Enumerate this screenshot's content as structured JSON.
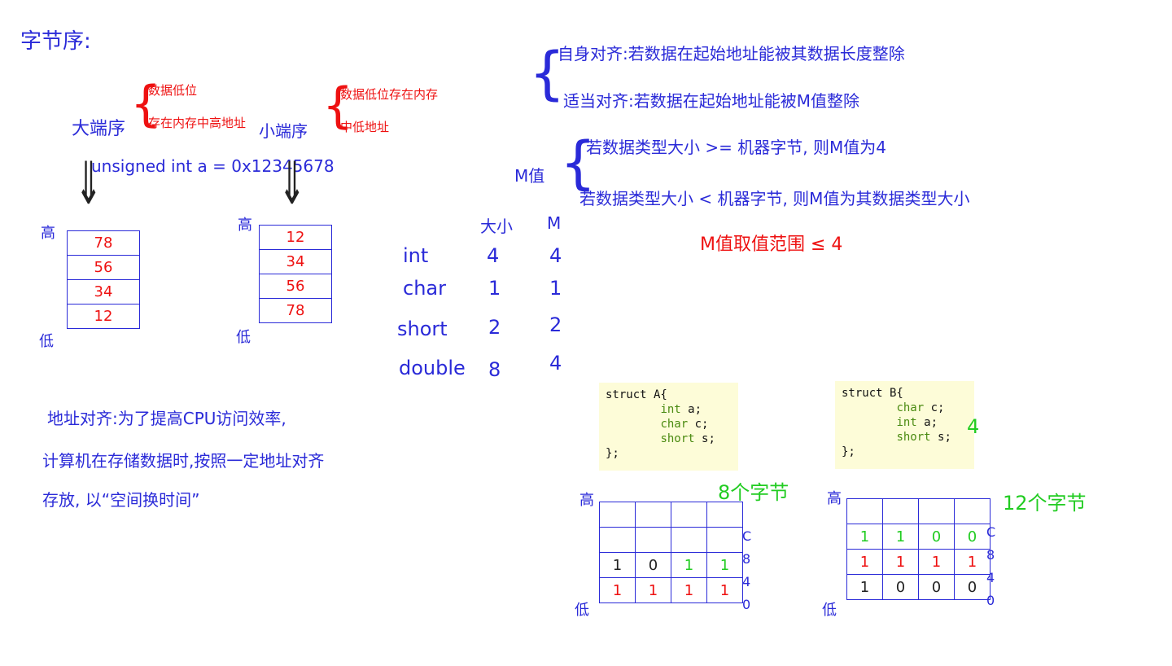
{
  "colors": {
    "blue": "#2a2ad8",
    "red": "#ee1111",
    "green": "#22cc22",
    "code_bg": "#fdfcd8"
  },
  "title": "字节序:",
  "big_endian": {
    "label": "大端序",
    "note1": "数据低位",
    "note2": "存在内存中高地址"
  },
  "little_endian": {
    "label": "小端序",
    "note1": "数据低位存在内存",
    "note2": "中低地址"
  },
  "declaration": "unsigned int a = 0x12345678",
  "high": "高",
  "low": "低",
  "big_cells": [
    "78",
    "56",
    "34",
    "12"
  ],
  "little_cells": [
    "12",
    "34",
    "56",
    "78"
  ],
  "size_table": {
    "headers": [
      "大小",
      "M"
    ],
    "rows": [
      [
        "int",
        "4",
        "4"
      ],
      [
        "char",
        "1",
        "1"
      ],
      [
        "short",
        "2",
        "2"
      ],
      [
        "double",
        "8",
        "4"
      ]
    ]
  },
  "self_align": {
    "label": "自身对齐",
    "text": ":若数据在起始地址能被其数据长度整除"
  },
  "proper_align": {
    "label": "适当对齐",
    "text": ":若数据在起始地址能被M值整除"
  },
  "m_value": {
    "label": "M值",
    "rule1": "若数据类型大小 >= 机器字节, 则M值为4",
    "rule2": "若数据类型大小 < 机器字节, 则M值为其数据类型大小",
    "range": "M值取值范围 ≤ 4"
  },
  "addr_align": {
    "line1": "地址对齐:为了提高CPU访问效率,",
    "line2": "计算机在存储数据时,按照一定地址对齐",
    "line3": "存放, 以“空间换时间”"
  },
  "struct_a": {
    "line0": "struct A{",
    "fields": [
      [
        "int",
        "a;"
      ],
      [
        "char",
        "c;"
      ],
      [
        "short",
        "s;"
      ]
    ],
    "close": "};",
    "size": "8个字节",
    "rows": [
      [
        "",
        "",
        "",
        ""
      ],
      [
        "",
        "",
        "",
        ""
      ],
      [
        "1",
        "0",
        "1",
        "1"
      ],
      [
        "1",
        "1",
        "1",
        "1"
      ]
    ]
  },
  "struct_b": {
    "line0": "struct B{",
    "fields": [
      [
        "char",
        "c;"
      ],
      [
        "int",
        "a;"
      ],
      [
        "short",
        "s;"
      ]
    ],
    "close": "};",
    "size": "12个字节",
    "note": "4",
    "rows": [
      [
        "",
        "",
        "",
        ""
      ],
      [
        "1",
        "1",
        "0",
        "0"
      ],
      [
        "1",
        "1",
        "1",
        "1"
      ],
      [
        "1",
        "0",
        "0",
        "0"
      ]
    ]
  },
  "offsets": [
    "C",
    "8",
    "4",
    "0"
  ]
}
